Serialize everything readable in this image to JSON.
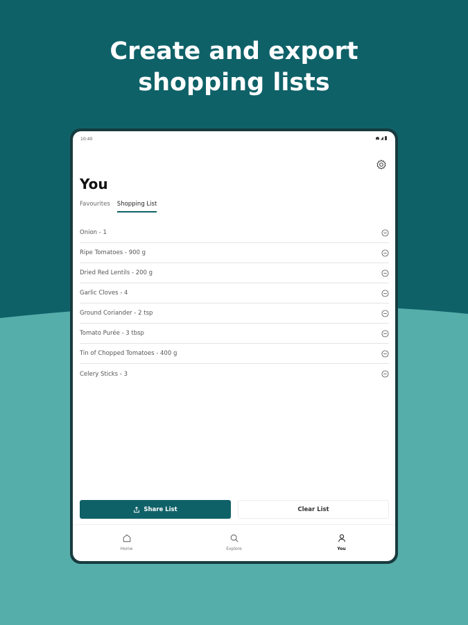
{
  "headline": {
    "line1": "Create and export",
    "line2": "shopping lists"
  },
  "status_bar": {
    "time": "10:40"
  },
  "page": {
    "title": "You"
  },
  "tabs": [
    {
      "label": "Favourites",
      "active": false
    },
    {
      "label": "Shopping List",
      "active": true
    }
  ],
  "shopping_list": [
    {
      "label": "Onion - 1"
    },
    {
      "label": "Ripe Tomatoes - 900 g"
    },
    {
      "label": "Dried Red Lentils - 200 g"
    },
    {
      "label": "Garlic Cloves - 4"
    },
    {
      "label": "Ground Coriander - 2 tsp"
    },
    {
      "label": "Tomato Purée - 3 tbsp"
    },
    {
      "label": "Tin of Chopped Tomatoes - 400 g"
    },
    {
      "label": "Celery Sticks - 3"
    }
  ],
  "actions": {
    "share_label": "Share List",
    "clear_label": "Clear List"
  },
  "nav": [
    {
      "label": "Home",
      "icon": "home-icon",
      "active": false
    },
    {
      "label": "Explore",
      "icon": "search-icon",
      "active": false
    },
    {
      "label": "You",
      "icon": "user-icon",
      "active": true
    }
  ],
  "colors": {
    "dark_teal": "#0f6168",
    "light_teal": "#56aeab",
    "device_frame": "#173b3f"
  }
}
